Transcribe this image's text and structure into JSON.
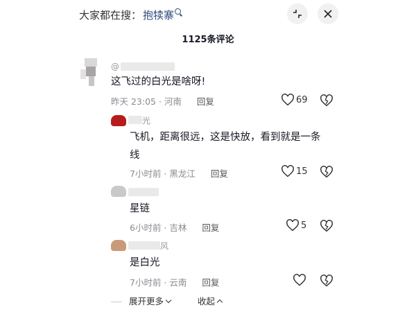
{
  "header": {
    "search_prefix": "大家都在搜：",
    "search_keyword": "抱犊寨",
    "comment_count": "1125条评论"
  },
  "comments": [
    {
      "handle": "@",
      "text": "这飞过的白光是啥呀!",
      "time_loc": "昨天 23:05 · 河南",
      "reply": "回复",
      "likes": "69"
    },
    {
      "handle": "光",
      "text_lines": [
        "飞机，距离很远，这是快放，看到就是一条",
        "线"
      ],
      "time_loc": "7小时前 · 黑龙江",
      "reply": "回复",
      "likes": "15"
    },
    {
      "handle": "",
      "text": "星链",
      "time_loc": "6小时前 · 吉林",
      "reply": "回复",
      "likes": "5"
    },
    {
      "handle": "风",
      "text": "是白光",
      "time_loc": "7小时前 · 云南",
      "reply": "回复",
      "likes": ""
    }
  ],
  "footer": {
    "expand_more": "展开更多",
    "collapse": "收起"
  },
  "icons": {
    "like": "heart-outline-icon",
    "dislike": "broken-heart-icon",
    "collapse": "shrink-arrows-icon",
    "close": "close-icon",
    "search": "search-icon"
  },
  "colors": {
    "keyword": "#2f4a78",
    "meta_gray": "#8a8b91",
    "text": "#161823"
  }
}
